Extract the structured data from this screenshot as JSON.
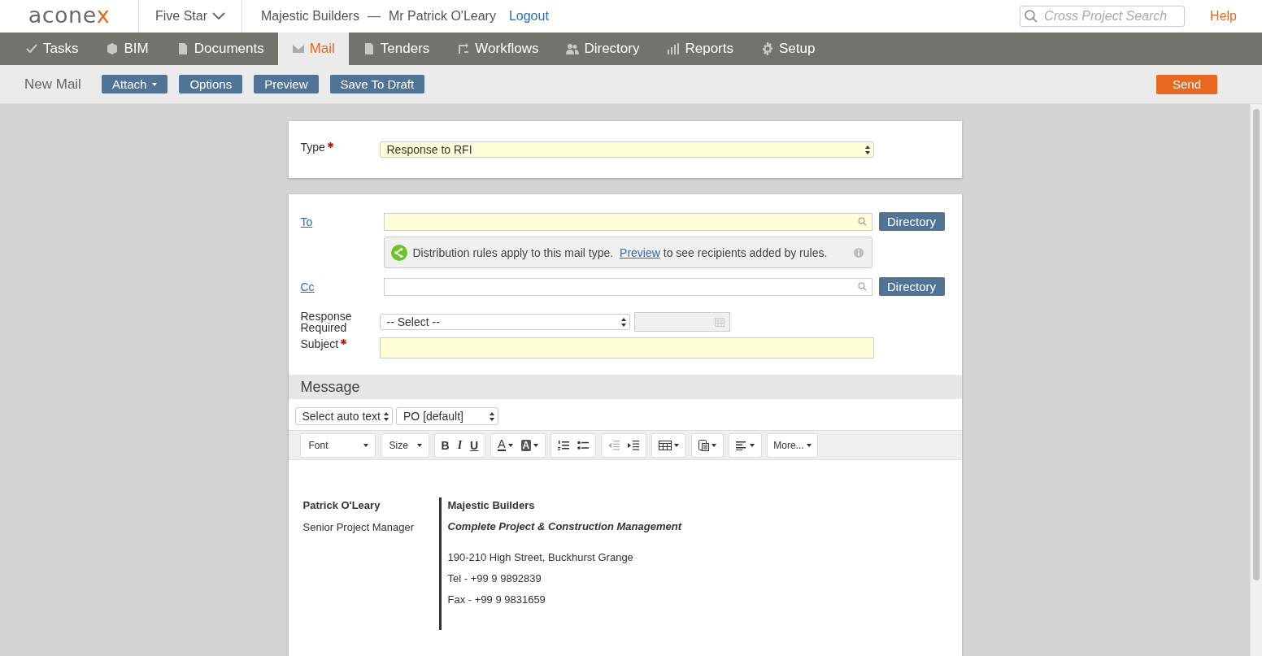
{
  "logo": {
    "main": "acone",
    "accent": "x"
  },
  "project": "Five Star",
  "org": "Majestic Builders",
  "separator": "—",
  "user": "Mr Patrick O'Leary",
  "logout": "Logout",
  "search": {
    "placeholder": "Cross Project Search"
  },
  "help": "Help",
  "nav": [
    {
      "label": "Tasks",
      "selected": false
    },
    {
      "label": "BIM",
      "selected": false
    },
    {
      "label": "Documents",
      "selected": false
    },
    {
      "label": "Mail",
      "selected": true
    },
    {
      "label": "Tenders",
      "selected": false
    },
    {
      "label": "Workflows",
      "selected": false
    },
    {
      "label": "Directory",
      "selected": false
    },
    {
      "label": "Reports",
      "selected": false
    },
    {
      "label": "Setup",
      "selected": false
    }
  ],
  "page_title": "New Mail",
  "actions": [
    {
      "label": "Attach",
      "dropdown": true
    },
    {
      "label": "Options",
      "dropdown": false
    },
    {
      "label": "Preview",
      "dropdown": false
    },
    {
      "label": "Save To Draft",
      "dropdown": false
    }
  ],
  "send": "Send",
  "type": {
    "label": "Type",
    "required": true,
    "value": "Response to RFI"
  },
  "to": {
    "label": "To",
    "directory": "Directory"
  },
  "notice": {
    "before": "Distribution rules apply to this mail type.",
    "link": "Preview",
    "after": "to see recipients added by rules."
  },
  "cc": {
    "label": "Cc",
    "directory": "Directory"
  },
  "response": {
    "label": "Response Required",
    "value": "-- Select --"
  },
  "subject": {
    "label": "Subject",
    "required": true
  },
  "message": {
    "title": "Message",
    "auto_text": "Select auto text",
    "template": "PO [default]"
  },
  "editor_toolbar": [
    {
      "items": [
        {
          "kind": "select",
          "label": "Font"
        }
      ]
    },
    {
      "items": [
        {
          "kind": "select",
          "label": "Size"
        }
      ]
    },
    {
      "items": [
        {
          "kind": "bold",
          "label": "B"
        },
        {
          "kind": "italic",
          "label": "I"
        },
        {
          "kind": "underline",
          "label": "U"
        }
      ]
    },
    {
      "items": [
        {
          "kind": "forecolor",
          "label": "A"
        },
        {
          "kind": "backcolor",
          "label": "A"
        }
      ]
    },
    {
      "items": [
        {
          "kind": "ol"
        },
        {
          "kind": "ul"
        }
      ]
    },
    {
      "items": [
        {
          "kind": "outdent"
        },
        {
          "kind": "indent"
        }
      ]
    },
    {
      "items": [
        {
          "kind": "table"
        }
      ]
    },
    {
      "items": [
        {
          "kind": "paste"
        }
      ]
    },
    {
      "items": [
        {
          "kind": "align"
        }
      ]
    },
    {
      "items": [
        {
          "kind": "more",
          "label": "More..."
        }
      ]
    }
  ],
  "signature": {
    "name": "Patrick O'Leary",
    "role": "Senior Project Manager",
    "company": "Majestic Builders",
    "tagline": "Complete Project & Construction Management",
    "lines": [
      "190-210 High Street, Buckhurst Grange",
      "Tel - +99 9 9892839",
      "Fax - +99 9 9831659"
    ]
  }
}
